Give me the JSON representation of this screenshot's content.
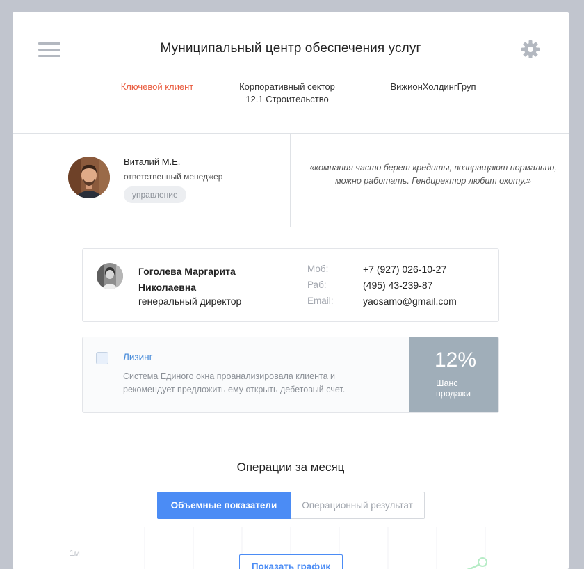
{
  "header": {
    "title": "Муниципальный центр обеспечения услуг",
    "menu_icon": "menu-icon",
    "settings_icon": "gear-icon"
  },
  "tags": {
    "key_client": "Ключевой клиент",
    "sector_line1": "Корпоративный сектор",
    "sector_line2": "12.1 Строительство",
    "company": "ВижионХолдингГруп"
  },
  "manager": {
    "name": "Виталий М.Е.",
    "role": "ответственный менеджер",
    "badge": "управление",
    "note": "«компания часто берет кредиты, возвращают нормально, можно работать. Гендиректор любит охоту.»"
  },
  "contact": {
    "name_line1": "Гоголева Маргарита",
    "name_line2": "Николаевна",
    "role": "генеральный директор",
    "mobile_label": "Моб:",
    "mobile_value": "+7 (927) 026-10-27",
    "work_label": "Раб:",
    "work_value": "(495) 43-239-87",
    "email_label": "Email:",
    "email_value": "yaosamo@gmail.com"
  },
  "offer": {
    "title": "Лизинг",
    "description": "Система Единого окна проанализировала клиента и рекомендует предложить ему открыть дебетовый счет.",
    "chance_value": "12%",
    "chance_label_line1": "Шанс",
    "chance_label_line2": "продажи",
    "checked": false
  },
  "operations": {
    "title": "Операции за месяц",
    "tabs": [
      {
        "label": "Объемные показатели",
        "active": true
      },
      {
        "label": "Операционный результат",
        "active": false
      }
    ],
    "y_tick": "1м",
    "show_chart_button": "Показать график"
  },
  "colors": {
    "accent": "#4b8cf5",
    "key_client": "#e95b3e",
    "stat_bg": "#a0aeb9",
    "chart_line": "#b6ecc6"
  }
}
